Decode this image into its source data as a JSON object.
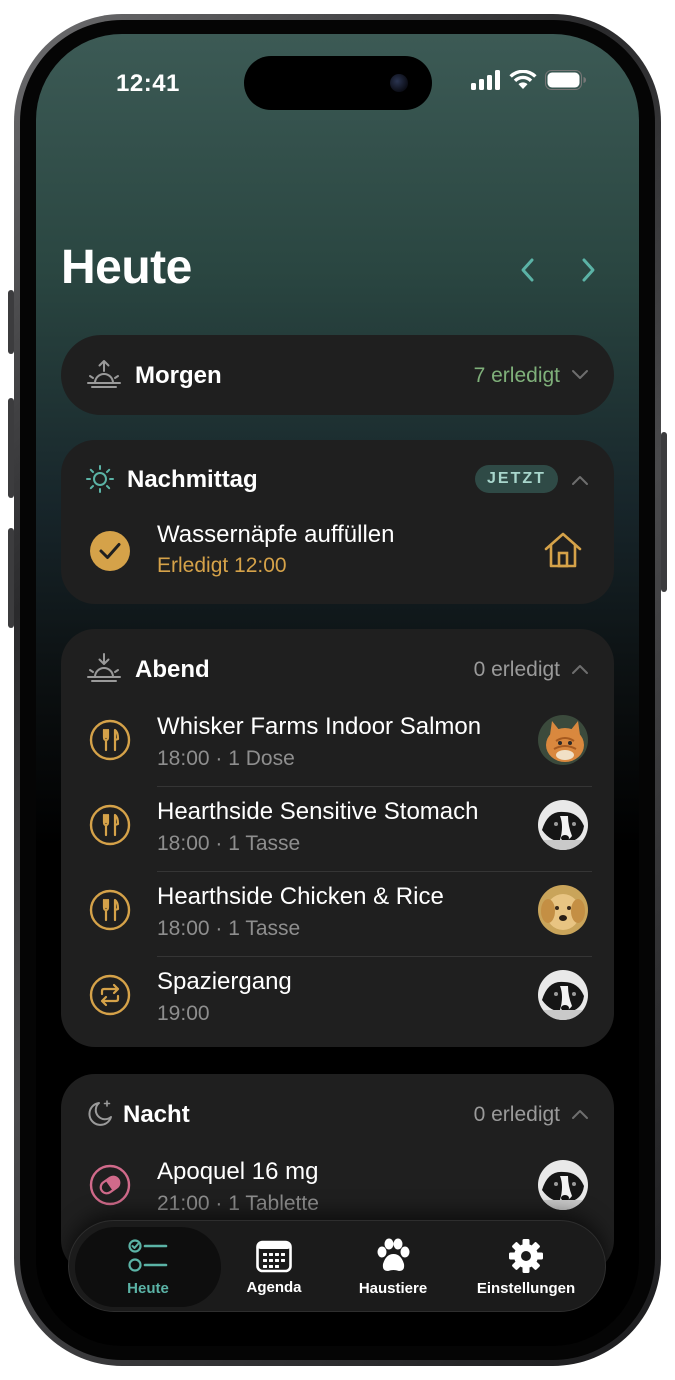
{
  "status_bar": {
    "time": "12:41"
  },
  "header": {
    "title": "Heute"
  },
  "sections": {
    "morning": {
      "title": "Morgen",
      "status": "7 erledigt"
    },
    "afternoon": {
      "title": "Nachmittag",
      "badge": "JETZT",
      "tasks": [
        {
          "title": "Wassernäpfe auffüllen",
          "subtitle": "Erledigt 12:00",
          "icon": "house-icon",
          "completed": true
        }
      ]
    },
    "evening": {
      "title": "Abend",
      "status": "0 erledigt",
      "tasks": [
        {
          "title": "Whisker Farms Indoor Salmon",
          "subtitle": "18:00 · 1 Dose",
          "icon": "fork-knife-icon",
          "pet": "cat-avatar"
        },
        {
          "title": "Hearthside Sensitive Stomach",
          "subtitle": "18:00 · 1 Tasse",
          "icon": "fork-knife-icon",
          "pet": "dog-bw-avatar"
        },
        {
          "title": "Hearthside Chicken & Rice",
          "subtitle": "18:00 · 1 Tasse",
          "icon": "fork-knife-icon",
          "pet": "golden-dog-avatar"
        },
        {
          "title": "Spaziergang",
          "subtitle": "19:00",
          "icon": "repeat-icon",
          "pet": "dog-bw-avatar"
        }
      ]
    },
    "night": {
      "title": "Nacht",
      "status": "0 erledigt",
      "tasks": [
        {
          "title": "Apoquel 16 mg",
          "subtitle": "21:00 · 1 Tablette",
          "icon": "pill-icon",
          "pet": "dog-bw-avatar"
        }
      ]
    }
  },
  "tabbar": {
    "tabs": [
      {
        "label": "Heute",
        "icon": "checklist-icon",
        "active": true
      },
      {
        "label": "Agenda",
        "icon": "calendar-icon",
        "active": false
      },
      {
        "label": "Haustiere",
        "icon": "paw-icon",
        "active": false
      },
      {
        "label": "Einstellungen",
        "icon": "gear-icon",
        "active": false
      }
    ]
  },
  "colors": {
    "accent_teal": "#5bb3a6",
    "accent_gold": "#d5a249",
    "done_green": "#7fb07a",
    "pill_pink": "#d06a8a",
    "card_bg": "#1f1f1f"
  }
}
